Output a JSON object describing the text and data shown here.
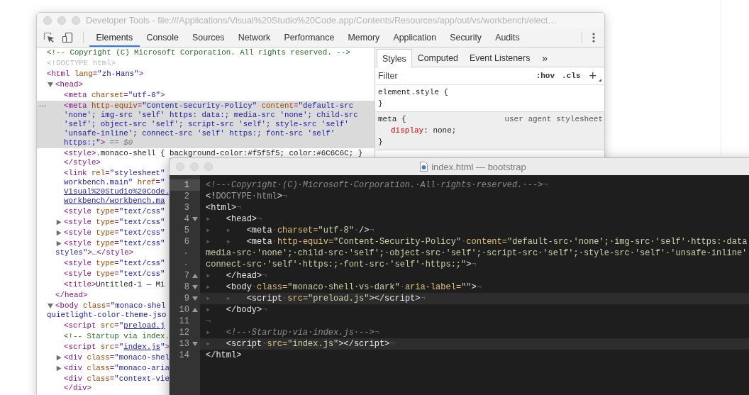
{
  "devtools": {
    "title": "Developer Tools - file:///Applications/Visual%20Studio%20Code.app/Contents/Resources/app/out/vs/workbench/elect…",
    "tabs": [
      {
        "label": "Elements",
        "selected": true
      },
      {
        "label": "Console",
        "selected": false
      },
      {
        "label": "Sources",
        "selected": false
      },
      {
        "label": "Network",
        "selected": false
      },
      {
        "label": "Performance",
        "selected": false
      },
      {
        "label": "Memory",
        "selected": false
      },
      {
        "label": "Application",
        "selected": false
      },
      {
        "label": "Security",
        "selected": false
      },
      {
        "label": "Audits",
        "selected": false
      }
    ],
    "elements": {
      "tree": [
        {
          "selected": false,
          "lines": [
            [
              {
                "kind": "comment",
                "text": "<!-- Copyright (C) Microsoft Corporation. All rights reserved. -->"
              }
            ]
          ]
        },
        {
          "selected": false,
          "lines": [
            [
              {
                "kind": "doctype",
                "text": "<!DOCTYPE html>"
              }
            ]
          ]
        },
        {
          "selected": false,
          "lines": [
            [
              {
                "kind": "tag",
                "text": "<html"
              },
              {
                "kind": "attr",
                "text": " lang"
              },
              {
                "kind": "tag",
                "text": "="
              },
              {
                "kind": "value",
                "text": "\"zh-Hans\""
              },
              {
                "kind": "tag",
                "text": ">"
              }
            ]
          ],
          "children": [
            {
              "selected": false,
              "expanded": true,
              "lines": [
                [
                  {
                    "kind": "tag",
                    "text": "<head>"
                  }
                ]
              ],
              "closing": [
                {
                  "kind": "tag",
                  "text": "</head>"
                }
              ],
              "children": [
                {
                  "selected": false,
                  "lines": [
                    [
                      {
                        "kind": "tag",
                        "text": "<meta"
                      },
                      {
                        "kind": "attr",
                        "text": " charset"
                      },
                      {
                        "kind": "tag",
                        "text": "="
                      },
                      {
                        "kind": "value",
                        "text": "\"utf-8\""
                      },
                      {
                        "kind": "tag",
                        "text": ">"
                      }
                    ]
                  ]
                },
                {
                  "selected": true,
                  "lines": [
                    [
                      {
                        "kind": "tag",
                        "text": "<meta"
                      },
                      {
                        "kind": "attr",
                        "text": " http-equiv"
                      },
                      {
                        "kind": "tag",
                        "text": "="
                      },
                      {
                        "kind": "value",
                        "text": "\"Content-Security-Policy\""
                      },
                      {
                        "kind": "attr",
                        "text": " content"
                      },
                      {
                        "kind": "tag",
                        "text": "="
                      },
                      {
                        "kind": "value",
                        "text": "\"default-src"
                      }
                    ],
                    [
                      {
                        "kind": "value",
                        "text": "'none'; img-src 'self' https: data:; media-src 'none'; child-src"
                      }
                    ],
                    [
                      {
                        "kind": "value",
                        "text": "'self'; object-src 'self'; script-src 'self'; style-src 'self'"
                      }
                    ],
                    [
                      {
                        "kind": "value",
                        "text": "'unsafe-inline'; connect-src 'self' https:; font-src 'self'"
                      }
                    ],
                    [
                      {
                        "kind": "value",
                        "text": "https:;\""
                      },
                      {
                        "kind": "tag",
                        "text": ">"
                      },
                      {
                        "kind": "ref",
                        "text": " == *$0*"
                      }
                    ]
                  ]
                },
                {
                  "selected": false,
                  "lines": [
                    [
                      {
                        "kind": "tag",
                        "text": "<style>"
                      },
                      {
                        "kind": "text",
                        "text": ".monaco-shell { background-color:#f5f5f5; color:#6C6C6C; }"
                      }
                    ]
                  ],
                  "closing": [
                    {
                      "kind": "tag",
                      "text": "</style>"
                    }
                  ]
                },
                {
                  "selected": false,
                  "lines": [
                    [
                      {
                        "kind": "tag",
                        "text": "<link"
                      },
                      {
                        "kind": "attr",
                        "text": " rel"
                      },
                      {
                        "kind": "tag",
                        "text": "="
                      },
                      {
                        "kind": "value",
                        "text": "\"stylesheet\""
                      }
                    ],
                    [
                      {
                        "kind": "value",
                        "text": "workbench.main\""
                      },
                      {
                        "kind": "attr",
                        "text": " href"
                      },
                      {
                        "kind": "tag",
                        "text": "="
                      },
                      {
                        "kind": "value",
                        "text": "\""
                      }
                    ],
                    [
                      {
                        "kind": "link",
                        "text": "Visual%20Studio%20Code."
                      }
                    ],
                    [
                      {
                        "kind": "link",
                        "text": "workbench/workbench.ma"
                      }
                    ]
                  ]
                },
                {
                  "selected": false,
                  "lines": [
                    [
                      {
                        "kind": "tag",
                        "text": "<style"
                      },
                      {
                        "kind": "attr",
                        "text": " type"
                      },
                      {
                        "kind": "tag",
                        "text": "="
                      },
                      {
                        "kind": "value",
                        "text": "\"text/css\""
                      }
                    ]
                  ]
                },
                {
                  "selected": false,
                  "expanded": false,
                  "lines": [
                    [
                      {
                        "kind": "tag",
                        "text": "<style"
                      },
                      {
                        "kind": "attr",
                        "text": " type"
                      },
                      {
                        "kind": "tag",
                        "text": "="
                      },
                      {
                        "kind": "value",
                        "text": "\"text/css\""
                      }
                    ]
                  ]
                },
                {
                  "selected": false,
                  "expanded": false,
                  "lines": [
                    [
                      {
                        "kind": "tag",
                        "text": "<style"
                      },
                      {
                        "kind": "attr",
                        "text": " type"
                      },
                      {
                        "kind": "tag",
                        "text": "="
                      },
                      {
                        "kind": "value",
                        "text": "\"text/css\""
                      }
                    ]
                  ]
                },
                {
                  "selected": false,
                  "expanded": false,
                  "lines": [
                    [
                      {
                        "kind": "tag",
                        "text": "<style"
                      },
                      {
                        "kind": "attr",
                        "text": " type"
                      },
                      {
                        "kind": "tag",
                        "text": "="
                      },
                      {
                        "kind": "value",
                        "text": "\"text/css\""
                      }
                    ],
                    [
                      {
                        "kind": "value",
                        "text": "styles\""
                      },
                      {
                        "kind": "tag",
                        "text": ">…</style>"
                      }
                    ]
                  ]
                },
                {
                  "selected": false,
                  "lines": [
                    [
                      {
                        "kind": "tag",
                        "text": "<style"
                      },
                      {
                        "kind": "attr",
                        "text": " type"
                      },
                      {
                        "kind": "tag",
                        "text": "="
                      },
                      {
                        "kind": "value",
                        "text": "\"text/css\""
                      }
                    ]
                  ]
                },
                {
                  "selected": false,
                  "lines": [
                    [
                      {
                        "kind": "tag",
                        "text": "<style"
                      },
                      {
                        "kind": "attr",
                        "text": " type"
                      },
                      {
                        "kind": "tag",
                        "text": "="
                      },
                      {
                        "kind": "value",
                        "text": "\"text/css\""
                      }
                    ]
                  ]
                },
                {
                  "selected": false,
                  "lines": [
                    [
                      {
                        "kind": "tag",
                        "text": "<title>"
                      },
                      {
                        "kind": "text",
                        "text": "Untitled-1 — Mi"
                      }
                    ]
                  ]
                }
              ]
            },
            {
              "selected": false,
              "expanded": true,
              "lines": [
                [
                  {
                    "kind": "tag",
                    "text": "<body"
                  },
                  {
                    "kind": "attr",
                    "text": " class"
                  },
                  {
                    "kind": "tag",
                    "text": "="
                  },
                  {
                    "kind": "value",
                    "text": "\"monaco-shel"
                  }
                ],
                [
                  {
                    "kind": "value",
                    "text": "quietlight-color-theme-jso"
                  }
                ]
              ],
              "children": [
                {
                  "selected": false,
                  "lines": [
                    [
                      {
                        "kind": "tag",
                        "text": "<script"
                      },
                      {
                        "kind": "attr",
                        "text": " src"
                      },
                      {
                        "kind": "tag",
                        "text": "="
                      },
                      {
                        "kind": "value",
                        "text": "\""
                      },
                      {
                        "kind": "link",
                        "text": "preload.j"
                      }
                    ]
                  ]
                },
                {
                  "selected": false,
                  "lines": [
                    [
                      {
                        "kind": "comment",
                        "text": "<!-- Startup via index."
                      }
                    ]
                  ]
                },
                {
                  "selected": false,
                  "lines": [
                    [
                      {
                        "kind": "tag",
                        "text": "<script"
                      },
                      {
                        "kind": "attr",
                        "text": " src"
                      },
                      {
                        "kind": "tag",
                        "text": "="
                      },
                      {
                        "kind": "value",
                        "text": "\""
                      },
                      {
                        "kind": "link",
                        "text": "index.js"
                      },
                      {
                        "kind": "value",
                        "text": "\""
                      },
                      {
                        "kind": "tag",
                        "text": ">"
                      }
                    ]
                  ]
                },
                {
                  "selected": false,
                  "expanded": false,
                  "lines": [
                    [
                      {
                        "kind": "tag",
                        "text": "<div"
                      },
                      {
                        "kind": "attr",
                        "text": " class"
                      },
                      {
                        "kind": "tag",
                        "text": "="
                      },
                      {
                        "kind": "value",
                        "text": "\"monaco-shel"
                      }
                    ]
                  ]
                },
                {
                  "selected": false,
                  "expanded": false,
                  "lines": [
                    [
                      {
                        "kind": "tag",
                        "text": "<div"
                      },
                      {
                        "kind": "attr",
                        "text": " class"
                      },
                      {
                        "kind": "tag",
                        "text": "="
                      },
                      {
                        "kind": "value",
                        "text": "\"monaco-aria"
                      }
                    ]
                  ]
                },
                {
                  "selected": false,
                  "lines": [
                    [
                      {
                        "kind": "tag",
                        "text": "<div"
                      },
                      {
                        "kind": "attr",
                        "text": " class"
                      },
                      {
                        "kind": "tag",
                        "text": "="
                      },
                      {
                        "kind": "value",
                        "text": "\"context-vie"
                      }
                    ]
                  ],
                  "closing": [
                    {
                      "kind": "tag",
                      "text": "</div>"
                    }
                  ]
                }
              ]
            }
          ]
        }
      ]
    },
    "styles": {
      "tabs": [
        {
          "label": "Styles",
          "selected": true
        },
        {
          "label": "Computed",
          "selected": false
        },
        {
          "label": "Event Listeners",
          "selected": false
        }
      ],
      "more": "»",
      "filter": {
        "placeholder": "Filter"
      },
      "toggles": [
        ":hov",
        ".cls"
      ],
      "add": "+",
      "rules": [
        {
          "selector": "element.style {",
          "closing": "}",
          "readonly": false
        },
        {
          "selector": "meta {",
          "source": "user agent stylesheet",
          "declarations": [
            {
              "property": "display",
              "remainder": ": none;"
            }
          ],
          "closing": "}",
          "readonly": true
        }
      ]
    }
  },
  "editor": {
    "title": "index.html — bootstrap",
    "lines": [
      {
        "number": "1",
        "kind": "plain",
        "current": true,
        "highlighted": false,
        "segments": [
          [
            {
              "kind": "comment",
              "text": "<!--·Copyright·(C)·Microsoft·Corporation.·All·rights·reserved.·-->"
            },
            {
              "kind": "ws",
              "text": "¬"
            }
          ]
        ]
      },
      {
        "number": "2",
        "kind": "plain",
        "current": false,
        "highlighted": false,
        "segments": [
          [
            {
              "kind": "tag",
              "text": "<!"
            },
            {
              "kind": "doctype",
              "text": "DOCTYPE·html"
            },
            {
              "kind": "tag",
              "text": ">"
            },
            {
              "kind": "ws",
              "text": "¬"
            }
          ]
        ]
      },
      {
        "number": "3",
        "kind": "plain",
        "current": false,
        "highlighted": false,
        "segments": [
          [
            {
              "kind": "tag",
              "text": "<html>"
            },
            {
              "kind": "ws",
              "text": "¬"
            }
          ]
        ]
      },
      {
        "number": "4",
        "kind": "fold-start",
        "current": false,
        "highlighted": false,
        "segments": [
          [
            {
              "kind": "ws",
              "text": "▸   "
            },
            {
              "kind": "tag",
              "text": "<head>"
            },
            {
              "kind": "ws",
              "text": "¬"
            }
          ]
        ]
      },
      {
        "number": "5",
        "kind": "plain",
        "current": false,
        "highlighted": false,
        "segments": [
          [
            {
              "kind": "ws",
              "text": "▸   ▸   "
            },
            {
              "kind": "tag",
              "text": "<meta"
            },
            {
              "kind": "ws",
              "text": "·"
            },
            {
              "kind": "attr",
              "text": "charset="
            },
            {
              "kind": "value",
              "text": "\"utf-8\""
            },
            {
              "kind": "ws",
              "text": "·"
            },
            {
              "kind": "tag",
              "text": "/>"
            },
            {
              "kind": "ws",
              "text": "¬"
            }
          ]
        ]
      },
      {
        "number": "6",
        "kind": "plain",
        "current": false,
        "highlighted": false,
        "segments": [
          [
            {
              "kind": "ws",
              "text": "▸   ▸   "
            },
            {
              "kind": "tag",
              "text": "<meta"
            },
            {
              "kind": "ws",
              "text": "·"
            },
            {
              "kind": "attr",
              "text": "http-equiv="
            },
            {
              "kind": "value",
              "text": "\"Content-Security-Policy\""
            },
            {
              "kind": "ws",
              "text": "·"
            },
            {
              "kind": "attr",
              "text": "content="
            },
            {
              "kind": "value",
              "text": "\"default-src·'none';·img-src·'self'·https:·data"
            }
          ],
          [
            {
              "kind": "value",
              "text": "media-src·'none';·child-src·'self';·object-src·'self';·script-src·'self';·style-src·'self'·'unsafe-inline'"
            }
          ],
          [
            {
              "kind": "value",
              "text": "connect-src·'self'·https:;·font-src·'self'·https:;\""
            },
            {
              "kind": "tag",
              "text": ">"
            },
            {
              "kind": "ws",
              "text": "¬"
            }
          ]
        ]
      },
      {
        "number": "7",
        "kind": "fold-end",
        "current": false,
        "highlighted": false,
        "segments": [
          [
            {
              "kind": "ws",
              "text": "▸   "
            },
            {
              "kind": "tag",
              "text": "</head>"
            },
            {
              "kind": "ws",
              "text": "¬"
            }
          ]
        ]
      },
      {
        "number": "8",
        "kind": "fold-start",
        "current": false,
        "highlighted": false,
        "segments": [
          [
            {
              "kind": "ws",
              "text": "▸   "
            },
            {
              "kind": "tag",
              "text": "<body"
            },
            {
              "kind": "ws",
              "text": "·"
            },
            {
              "kind": "attr",
              "text": "class="
            },
            {
              "kind": "value",
              "text": "\"monaco-shell·vs-dark\""
            },
            {
              "kind": "ws",
              "text": "·"
            },
            {
              "kind": "attr",
              "text": "aria-label="
            },
            {
              "kind": "value",
              "text": "\"\""
            },
            {
              "kind": "tag",
              "text": ">"
            },
            {
              "kind": "ws",
              "text": "¬"
            }
          ]
        ]
      },
      {
        "number": "9",
        "kind": "fold-start",
        "current": false,
        "highlighted": true,
        "segments": [
          [
            {
              "kind": "ws",
              "text": "▸   ▸   "
            },
            {
              "kind": "tag",
              "text": "<script"
            },
            {
              "kind": "ws",
              "text": "·"
            },
            {
              "kind": "attr",
              "text": "src="
            },
            {
              "kind": "value",
              "text": "\"preload.js\""
            },
            {
              "kind": "tag",
              "text": "></script>"
            },
            {
              "kind": "ws",
              "text": "¬"
            }
          ]
        ]
      },
      {
        "number": "10",
        "kind": "fold-end",
        "current": false,
        "highlighted": false,
        "segments": [
          [
            {
              "kind": "ws",
              "text": "▸   "
            },
            {
              "kind": "tag",
              "text": "</body>"
            },
            {
              "kind": "ws",
              "text": "¬"
            }
          ]
        ]
      },
      {
        "number": "11",
        "kind": "plain",
        "current": false,
        "highlighted": false,
        "segments": [
          [
            {
              "kind": "ws",
              "text": "¬"
            }
          ]
        ]
      },
      {
        "number": "12",
        "kind": "plain",
        "current": false,
        "highlighted": false,
        "segments": [
          [
            {
              "kind": "ws",
              "text": "▸   "
            },
            {
              "kind": "comment",
              "text": "<!--·Startup·via·index.js·-->"
            },
            {
              "kind": "ws",
              "text": "¬"
            }
          ]
        ]
      },
      {
        "number": "13",
        "kind": "fold-start",
        "current": false,
        "highlighted": true,
        "segments": [
          [
            {
              "kind": "ws",
              "text": "▸   "
            },
            {
              "kind": "tag",
              "text": "<script"
            },
            {
              "kind": "ws",
              "text": "·"
            },
            {
              "kind": "attr",
              "text": "src="
            },
            {
              "kind": "value",
              "text": "\"index.js\""
            },
            {
              "kind": "tag",
              "text": "></script>"
            },
            {
              "kind": "ws",
              "text": "¬"
            }
          ]
        ]
      },
      {
        "number": "14",
        "kind": "plain",
        "current": false,
        "highlighted": false,
        "segments": [
          [
            {
              "kind": "tag",
              "text": "</html>"
            }
          ]
        ]
      }
    ]
  }
}
